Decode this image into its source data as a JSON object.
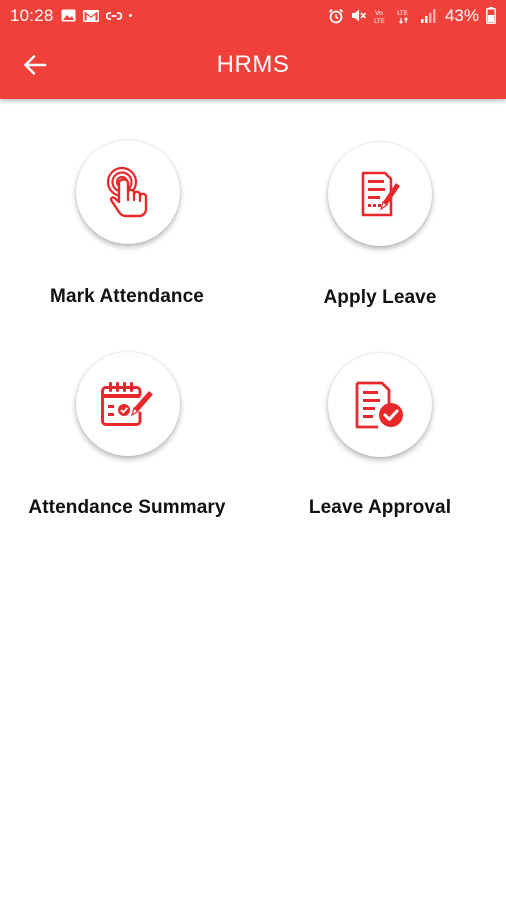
{
  "status_bar": {
    "time": "10:28",
    "battery_percent": "43%",
    "icons": [
      "gallery-icon",
      "gmail-icon",
      "link-icon",
      "alarm-icon",
      "mute-icon",
      "volte-icon",
      "lte-icon",
      "signal-icon",
      "battery-icon"
    ]
  },
  "app_bar": {
    "title": "HRMS",
    "back_icon": "arrow-left-icon"
  },
  "tiles": [
    {
      "label": "Mark Attendance",
      "icon": "touch-icon"
    },
    {
      "label": "Apply Leave",
      "icon": "form-edit-icon"
    },
    {
      "label": "Attendance Summary",
      "icon": "calendar-edit-icon"
    },
    {
      "label": "Leave Approval",
      "icon": "document-check-icon"
    }
  ],
  "colors": {
    "primary": "#f0403a",
    "icon_red": "#e8282b",
    "text": "#111111",
    "background": "#ffffff"
  }
}
